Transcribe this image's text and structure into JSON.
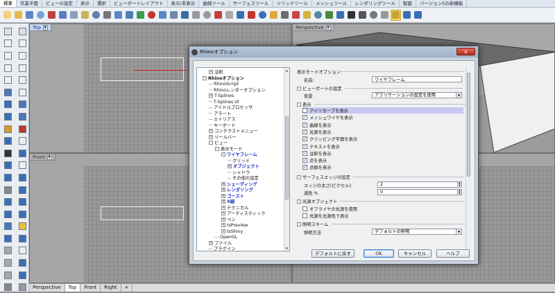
{
  "tabs": [
    "標準",
    "作業平面",
    "ビューの設定",
    "表示",
    "選択",
    "ビューポートレイアウト",
    "表示/非表示",
    "曲線ツール",
    "サーフェスツール",
    "ソリッドツール",
    "メッシュツール",
    "レンダリングツール",
    "製図",
    "バージョン5の新機能"
  ],
  "viewports": {
    "top": "Top",
    "perspective": "Perspective",
    "front": "Front"
  },
  "bottom_tabs": [
    "Perspective",
    "Top",
    "Front",
    "Right"
  ],
  "bottom_tab_add": "+",
  "dialog": {
    "title": "Rhinoオプション",
    "close": "x",
    "tree": [
      {
        "label": "注釈",
        "indent": 1,
        "pm": "+"
      },
      {
        "label": "Rhinoオプション",
        "indent": 0,
        "pm": "-",
        "bold": true
      },
      {
        "label": "RhinoScript",
        "indent": 1
      },
      {
        "label": "Rhinoレンダーオプション",
        "indent": 1
      },
      {
        "label": "T-Splines",
        "indent": 1,
        "pm": "+"
      },
      {
        "label": "T-Splines UI",
        "indent": 1
      },
      {
        "label": "アイドルプロセッサ",
        "indent": 1
      },
      {
        "label": "アラート",
        "indent": 1
      },
      {
        "label": "エイリアス",
        "indent": 1
      },
      {
        "label": "キーボード",
        "indent": 1
      },
      {
        "label": "コンテクストメニュー",
        "indent": 1,
        "pm": "+"
      },
      {
        "label": "ツールバー",
        "indent": 1,
        "pm": "+"
      },
      {
        "label": "ビュー",
        "indent": 1,
        "pm": "-"
      },
      {
        "label": "表示モード",
        "indent": 2,
        "pm": "-"
      },
      {
        "label": "ワイヤフレーム",
        "indent": 3,
        "pm": "-",
        "blue": true
      },
      {
        "label": "グリッド",
        "indent": 4
      },
      {
        "label": "オブジェクト",
        "indent": 4,
        "pm": "+",
        "blue": true
      },
      {
        "label": "シャドウ",
        "indent": 4
      },
      {
        "label": "その他の設定",
        "indent": 4
      },
      {
        "label": "シェーディング",
        "indent": 3,
        "pm": "+",
        "blue": true
      },
      {
        "label": "レンダリング",
        "indent": 3,
        "pm": "+",
        "blue": true
      },
      {
        "label": "ゴースト",
        "indent": 3,
        "pm": "+",
        "blue": true
      },
      {
        "label": "X線",
        "indent": 3,
        "pm": "+",
        "blue": true
      },
      {
        "label": "テクニカル",
        "indent": 3,
        "pm": "+"
      },
      {
        "label": "アーティスティック",
        "indent": 3,
        "pm": "+"
      },
      {
        "label": "ペン",
        "indent": 3,
        "pm": "+"
      },
      {
        "label": "tsPreview",
        "indent": 3,
        "pm": "+"
      },
      {
        "label": "tsShiny",
        "indent": 3,
        "pm": "+"
      },
      {
        "label": "OpenGL",
        "indent": 2
      },
      {
        "label": "ファイル",
        "indent": 1,
        "pm": "+"
      },
      {
        "label": "プラグイン",
        "indent": 1
      }
    ],
    "panel": {
      "heading": "表示モードオプション",
      "name_label": "名前:",
      "name_value": "ワイヤフレーム",
      "sec_viewport": "ビューポートの設定",
      "bg_label": "背景",
      "bg_value": "アプリケーションの設定を使用",
      "sec_display": "表示",
      "checks": [
        {
          "label": "アイソカーブを表示",
          "checked": false,
          "highlight": true
        },
        {
          "label": "メッシュワイヤを表示",
          "checked": true
        },
        {
          "label": "曲線を表示",
          "checked": true
        },
        {
          "label": "光源を表示",
          "checked": true
        },
        {
          "label": "クリッピング平面を表示",
          "checked": true
        },
        {
          "label": "テキストを表示",
          "checked": true
        },
        {
          "label": "注釈を表示",
          "checked": true
        },
        {
          "label": "点を表示",
          "checked": true
        },
        {
          "label": "点群を表示",
          "checked": true
        }
      ],
      "sec_edges": "サーフェスエッジの設定",
      "edge_width_label": "エッジの太さ(ピクセル):",
      "edge_width_value": "2",
      "fade_label": "減色 %",
      "fade_value": "0",
      "sec_lights": "光源オブジェクト",
      "light_checks": [
        {
          "label": "オフライヤの光源を使用",
          "checked": false
        },
        {
          "label": "光源を光源色で表示",
          "checked": false
        }
      ],
      "sec_lighting": "照明スキーム",
      "lighting_label": "照明方法",
      "lighting_value": "デフォルトの照明"
    },
    "buttons": {
      "restore": "デフォルトに戻す",
      "ok": "OK",
      "cancel": "キャンセル",
      "help": "ヘルプ"
    }
  }
}
